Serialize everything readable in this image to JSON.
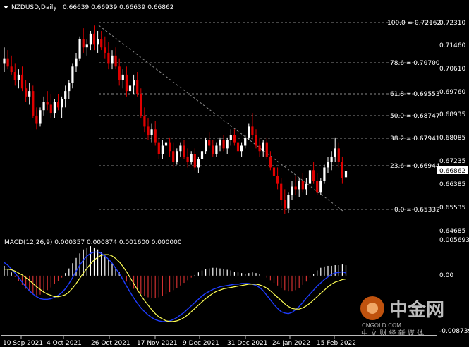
{
  "header": {
    "symbol": "NZDUSD,Daily",
    "ohlc": "0.66639 0.66939 0.66639 0.66862"
  },
  "price_axis": {
    "ticks": [
      "0.72310",
      "0.71460",
      "0.70610",
      "0.69760",
      "0.68935",
      "0.68085",
      "0.67235",
      "0.66385",
      "0.65535",
      "0.64685"
    ],
    "current_price": "0.66862"
  },
  "fibonacci": {
    "levels": [
      {
        "label": "100.0 = 0.72162",
        "price": 0.72162
      },
      {
        "label": "78.6 = 0.70700",
        "price": 0.707
      },
      {
        "label": "61.8 = 0.69553",
        "price": 0.69553
      },
      {
        "label": "50.0 = 0.68747",
        "price": 0.68747
      },
      {
        "label": "38.2 = 0.67941",
        "price": 0.67941
      },
      {
        "label": "23.6 = 0.66944",
        "price": 0.66944
      },
      {
        "label": "0.0 = 0.65332",
        "price": 0.65332
      }
    ]
  },
  "macd": {
    "label": "MACD(12,26,9) 0.000357 0.000874 0.001600 0.000000",
    "ticks": [
      "0.005693",
      "0.00",
      "-0.008739"
    ]
  },
  "time_axis": {
    "labels": [
      "10 Sep 2021",
      "4 Oct 2021",
      "26 Oct 2021",
      "17 Nov 2021",
      "9 Dec 2021",
      "31 Dec 2021",
      "24 Jan 2022",
      "15 Feb 2022"
    ]
  },
  "watermark": {
    "brand": "中金网",
    "domain": "CNGOLD.COM",
    "slogan": "中 文 财 经 新 媒 体"
  },
  "colors": {
    "bull": "#ffffff",
    "bear": "#e00000",
    "macd_line": "#1e3cff",
    "signal_line": "#ffff55",
    "hist_pos": "#ffffff",
    "hist_neg": "#d03030",
    "accent": "#e06010"
  },
  "chart_data": {
    "type": "candlestick",
    "price_range": [
      0.64685,
      0.7231
    ],
    "macd_range": [
      -0.008739,
      0.005693
    ],
    "candles": [
      [
        0.708,
        0.714,
        0.705,
        0.71
      ],
      [
        0.71,
        0.713,
        0.706,
        0.707
      ],
      [
        0.707,
        0.711,
        0.704,
        0.705
      ],
      [
        0.705,
        0.708,
        0.7,
        0.702
      ],
      [
        0.702,
        0.706,
        0.699,
        0.704
      ],
      [
        0.704,
        0.707,
        0.698,
        0.699
      ],
      [
        0.699,
        0.702,
        0.694,
        0.696
      ],
      [
        0.696,
        0.701,
        0.693,
        0.698
      ],
      [
        0.698,
        0.7,
        0.688,
        0.689
      ],
      [
        0.689,
        0.692,
        0.684,
        0.686
      ],
      [
        0.686,
        0.692,
        0.685,
        0.691
      ],
      [
        0.691,
        0.696,
        0.689,
        0.694
      ],
      [
        0.694,
        0.698,
        0.691,
        0.693
      ],
      [
        0.693,
        0.697,
        0.688,
        0.69
      ],
      [
        0.69,
        0.695,
        0.688,
        0.694
      ],
      [
        0.694,
        0.697,
        0.691,
        0.692
      ],
      [
        0.692,
        0.696,
        0.688,
        0.695
      ],
      [
        0.695,
        0.7,
        0.692,
        0.698
      ],
      [
        0.698,
        0.702,
        0.695,
        0.701
      ],
      [
        0.701,
        0.708,
        0.699,
        0.707
      ],
      [
        0.707,
        0.712,
        0.705,
        0.71
      ],
      [
        0.71,
        0.718,
        0.709,
        0.717
      ],
      [
        0.717,
        0.721,
        0.712,
        0.714
      ],
      [
        0.714,
        0.717,
        0.711,
        0.715
      ],
      [
        0.715,
        0.72,
        0.713,
        0.719
      ],
      [
        0.719,
        0.722,
        0.713,
        0.715
      ],
      [
        0.715,
        0.72,
        0.712,
        0.717
      ],
      [
        0.717,
        0.72,
        0.713,
        0.714
      ],
      [
        0.714,
        0.718,
        0.71,
        0.712
      ],
      [
        0.712,
        0.716,
        0.706,
        0.708
      ],
      [
        0.708,
        0.713,
        0.706,
        0.711
      ],
      [
        0.711,
        0.714,
        0.706,
        0.707
      ],
      [
        0.707,
        0.71,
        0.7,
        0.702
      ],
      [
        0.702,
        0.706,
        0.699,
        0.704
      ],
      [
        0.704,
        0.707,
        0.696,
        0.698
      ],
      [
        0.698,
        0.702,
        0.695,
        0.7
      ],
      [
        0.7,
        0.704,
        0.697,
        0.702
      ],
      [
        0.702,
        0.705,
        0.696,
        0.697
      ],
      [
        0.697,
        0.699,
        0.688,
        0.689
      ],
      [
        0.689,
        0.692,
        0.683,
        0.685
      ],
      [
        0.685,
        0.688,
        0.68,
        0.682
      ],
      [
        0.682,
        0.686,
        0.679,
        0.684
      ],
      [
        0.684,
        0.687,
        0.678,
        0.679
      ],
      [
        0.679,
        0.681,
        0.673,
        0.675
      ],
      [
        0.675,
        0.68,
        0.673,
        0.678
      ],
      [
        0.678,
        0.682,
        0.676,
        0.679
      ],
      [
        0.679,
        0.681,
        0.674,
        0.676
      ],
      [
        0.676,
        0.679,
        0.67,
        0.672
      ],
      [
        0.672,
        0.677,
        0.671,
        0.676
      ],
      [
        0.676,
        0.679,
        0.674,
        0.678
      ],
      [
        0.678,
        0.68,
        0.673,
        0.674
      ],
      [
        0.674,
        0.677,
        0.67,
        0.672
      ],
      [
        0.672,
        0.676,
        0.671,
        0.675
      ],
      [
        0.675,
        0.677,
        0.669,
        0.67
      ],
      [
        0.67,
        0.674,
        0.668,
        0.673
      ],
      [
        0.673,
        0.677,
        0.672,
        0.676
      ],
      [
        0.676,
        0.681,
        0.675,
        0.68
      ],
      [
        0.68,
        0.683,
        0.677,
        0.678
      ],
      [
        0.678,
        0.68,
        0.674,
        0.675
      ],
      [
        0.675,
        0.679,
        0.674,
        0.678
      ],
      [
        0.678,
        0.681,
        0.676,
        0.68
      ],
      [
        0.68,
        0.682,
        0.676,
        0.677
      ],
      [
        0.677,
        0.681,
        0.675,
        0.68
      ],
      [
        0.68,
        0.684,
        0.678,
        0.682
      ],
      [
        0.682,
        0.684,
        0.678,
        0.679
      ],
      [
        0.679,
        0.682,
        0.675,
        0.676
      ],
      [
        0.676,
        0.679,
        0.674,
        0.678
      ],
      [
        0.678,
        0.682,
        0.677,
        0.681
      ],
      [
        0.681,
        0.686,
        0.68,
        0.685
      ],
      [
        0.685,
        0.69,
        0.68,
        0.682
      ],
      [
        0.682,
        0.684,
        0.677,
        0.678
      ],
      [
        0.678,
        0.681,
        0.674,
        0.676
      ],
      [
        0.676,
        0.68,
        0.674,
        0.679
      ],
      [
        0.679,
        0.681,
        0.673,
        0.674
      ],
      [
        0.674,
        0.676,
        0.669,
        0.67
      ],
      [
        0.67,
        0.673,
        0.665,
        0.667
      ],
      [
        0.667,
        0.67,
        0.662,
        0.664
      ],
      [
        0.664,
        0.666,
        0.656,
        0.658
      ],
      [
        0.658,
        0.662,
        0.653,
        0.655
      ],
      [
        0.655,
        0.661,
        0.6533,
        0.66
      ],
      [
        0.66,
        0.665,
        0.658,
        0.663
      ],
      [
        0.663,
        0.667,
        0.66,
        0.662
      ],
      [
        0.662,
        0.666,
        0.659,
        0.665
      ],
      [
        0.665,
        0.668,
        0.661,
        0.662
      ],
      [
        0.662,
        0.666,
        0.66,
        0.664
      ],
      [
        0.664,
        0.67,
        0.663,
        0.669
      ],
      [
        0.669,
        0.672,
        0.664,
        0.665
      ],
      [
        0.665,
        0.668,
        0.66,
        0.661
      ],
      [
        0.661,
        0.666,
        0.66,
        0.665
      ],
      [
        0.665,
        0.671,
        0.664,
        0.67
      ],
      [
        0.67,
        0.674,
        0.668,
        0.672
      ],
      [
        0.672,
        0.676,
        0.669,
        0.674
      ],
      [
        0.674,
        0.681,
        0.672,
        0.677
      ],
      [
        0.677,
        0.679,
        0.67,
        0.672
      ],
      [
        0.672,
        0.674,
        0.664,
        0.666
      ],
      [
        0.6664,
        0.6694,
        0.6664,
        0.6686
      ]
    ],
    "macd_histogram": [
      0.0015,
      0.001,
      0.0005,
      -0.0002,
      -0.0008,
      -0.0014,
      -0.002,
      -0.0024,
      -0.0028,
      -0.003,
      -0.0029,
      -0.0026,
      -0.0022,
      -0.0018,
      -0.0013,
      -0.0008,
      -0.0003,
      0.0004,
      0.0011,
      0.0019,
      0.0027,
      0.0034,
      0.004,
      0.0043,
      0.0045,
      0.0043,
      0.004,
      0.0036,
      0.0031,
      0.0025,
      0.0019,
      0.0012,
      0.0005,
      -0.0002,
      -0.0009,
      -0.0015,
      -0.002,
      -0.0024,
      -0.0028,
      -0.0031,
      -0.0033,
      -0.0034,
      -0.0034,
      -0.0033,
      -0.0031,
      -0.0028,
      -0.0025,
      -0.0022,
      -0.0019,
      -0.0015,
      -0.0011,
      -0.0007,
      -0.0003,
      0.0001,
      0.0005,
      0.0008,
      0.001,
      0.0011,
      0.0012,
      0.0012,
      0.0011,
      0.001,
      0.0009,
      0.0008,
      0.0006,
      0.0005,
      0.0004,
      0.0003,
      0.0004,
      0.0005,
      0.0004,
      0.0002,
      0.0,
      -0.0003,
      -0.0007,
      -0.0011,
      -0.0015,
      -0.0019,
      -0.0022,
      -0.0024,
      -0.0024,
      -0.0022,
      -0.0019,
      -0.0014,
      -0.0009,
      -0.0003,
      0.0003,
      0.0008,
      0.0012,
      0.0014,
      0.0015,
      0.0015,
      0.0016,
      0.0016,
      0.0017,
      0.0016
    ],
    "macd_line": [
      0.002,
      0.0016,
      0.001,
      0.0004,
      -0.0003,
      -0.001,
      -0.0017,
      -0.0023,
      -0.0028,
      -0.0032,
      -0.0035,
      -0.0036,
      -0.0036,
      -0.0035,
      -0.0033,
      -0.003,
      -0.0026,
      -0.002,
      -0.0012,
      -0.0003,
      0.0007,
      0.0016,
      0.0024,
      0.003,
      0.0034,
      0.0036,
      0.0036,
      0.0034,
      0.003,
      0.0025,
      0.0019,
      0.0011,
      0.0003,
      -0.0006,
      -0.0016,
      -0.0025,
      -0.0034,
      -0.0042,
      -0.0049,
      -0.0055,
      -0.006,
      -0.0064,
      -0.0067,
      -0.0069,
      -0.007,
      -0.007,
      -0.0069,
      -0.0067,
      -0.0064,
      -0.006,
      -0.0056,
      -0.0051,
      -0.0046,
      -0.0041,
      -0.0036,
      -0.0031,
      -0.0027,
      -0.0024,
      -0.0021,
      -0.0019,
      -0.0017,
      -0.0016,
      -0.0015,
      -0.0014,
      -0.0013,
      -0.0013,
      -0.0012,
      -0.0012,
      -0.0012,
      -0.0013,
      -0.0015,
      -0.0018,
      -0.0023,
      -0.003,
      -0.0037,
      -0.0044,
      -0.005,
      -0.0055,
      -0.0057,
      -0.0058,
      -0.0056,
      -0.0052,
      -0.0047,
      -0.0041,
      -0.0034,
      -0.0028,
      -0.0022,
      -0.0016,
      -0.0011,
      -0.0006,
      -0.0002,
      0.0002,
      0.0004,
      0.0005,
      0.0006,
      0.0004
    ],
    "signal_line": [
      0.001,
      0.001,
      0.0009,
      0.0007,
      0.0004,
      0.0001,
      -0.0003,
      -0.0007,
      -0.0012,
      -0.0017,
      -0.0021,
      -0.0025,
      -0.0028,
      -0.003,
      -0.0032,
      -0.0032,
      -0.0031,
      -0.0029,
      -0.0025,
      -0.0019,
      -0.0012,
      -0.0004,
      0.0004,
      0.0011,
      0.0018,
      0.0024,
      0.0028,
      0.0031,
      0.0032,
      0.0032,
      0.003,
      0.0026,
      0.0021,
      0.0014,
      0.0006,
      -0.0003,
      -0.0012,
      -0.0021,
      -0.003,
      -0.0038,
      -0.0045,
      -0.0052,
      -0.0058,
      -0.0063,
      -0.0066,
      -0.0069,
      -0.007,
      -0.007,
      -0.0069,
      -0.0067,
      -0.0064,
      -0.006,
      -0.0055,
      -0.005,
      -0.0045,
      -0.004,
      -0.0035,
      -0.0031,
      -0.0027,
      -0.0024,
      -0.0022,
      -0.002,
      -0.0019,
      -0.0018,
      -0.0017,
      -0.0016,
      -0.0015,
      -0.0014,
      -0.0013,
      -0.0013,
      -0.0013,
      -0.0014,
      -0.0016,
      -0.0019,
      -0.0023,
      -0.0028,
      -0.0033,
      -0.0038,
      -0.0043,
      -0.0047,
      -0.005,
      -0.0051,
      -0.0051,
      -0.0049,
      -0.0046,
      -0.0042,
      -0.0037,
      -0.0032,
      -0.0027,
      -0.0022,
      -0.0017,
      -0.0013,
      -0.001,
      -0.0008,
      -0.0006,
      -0.0005
    ]
  }
}
